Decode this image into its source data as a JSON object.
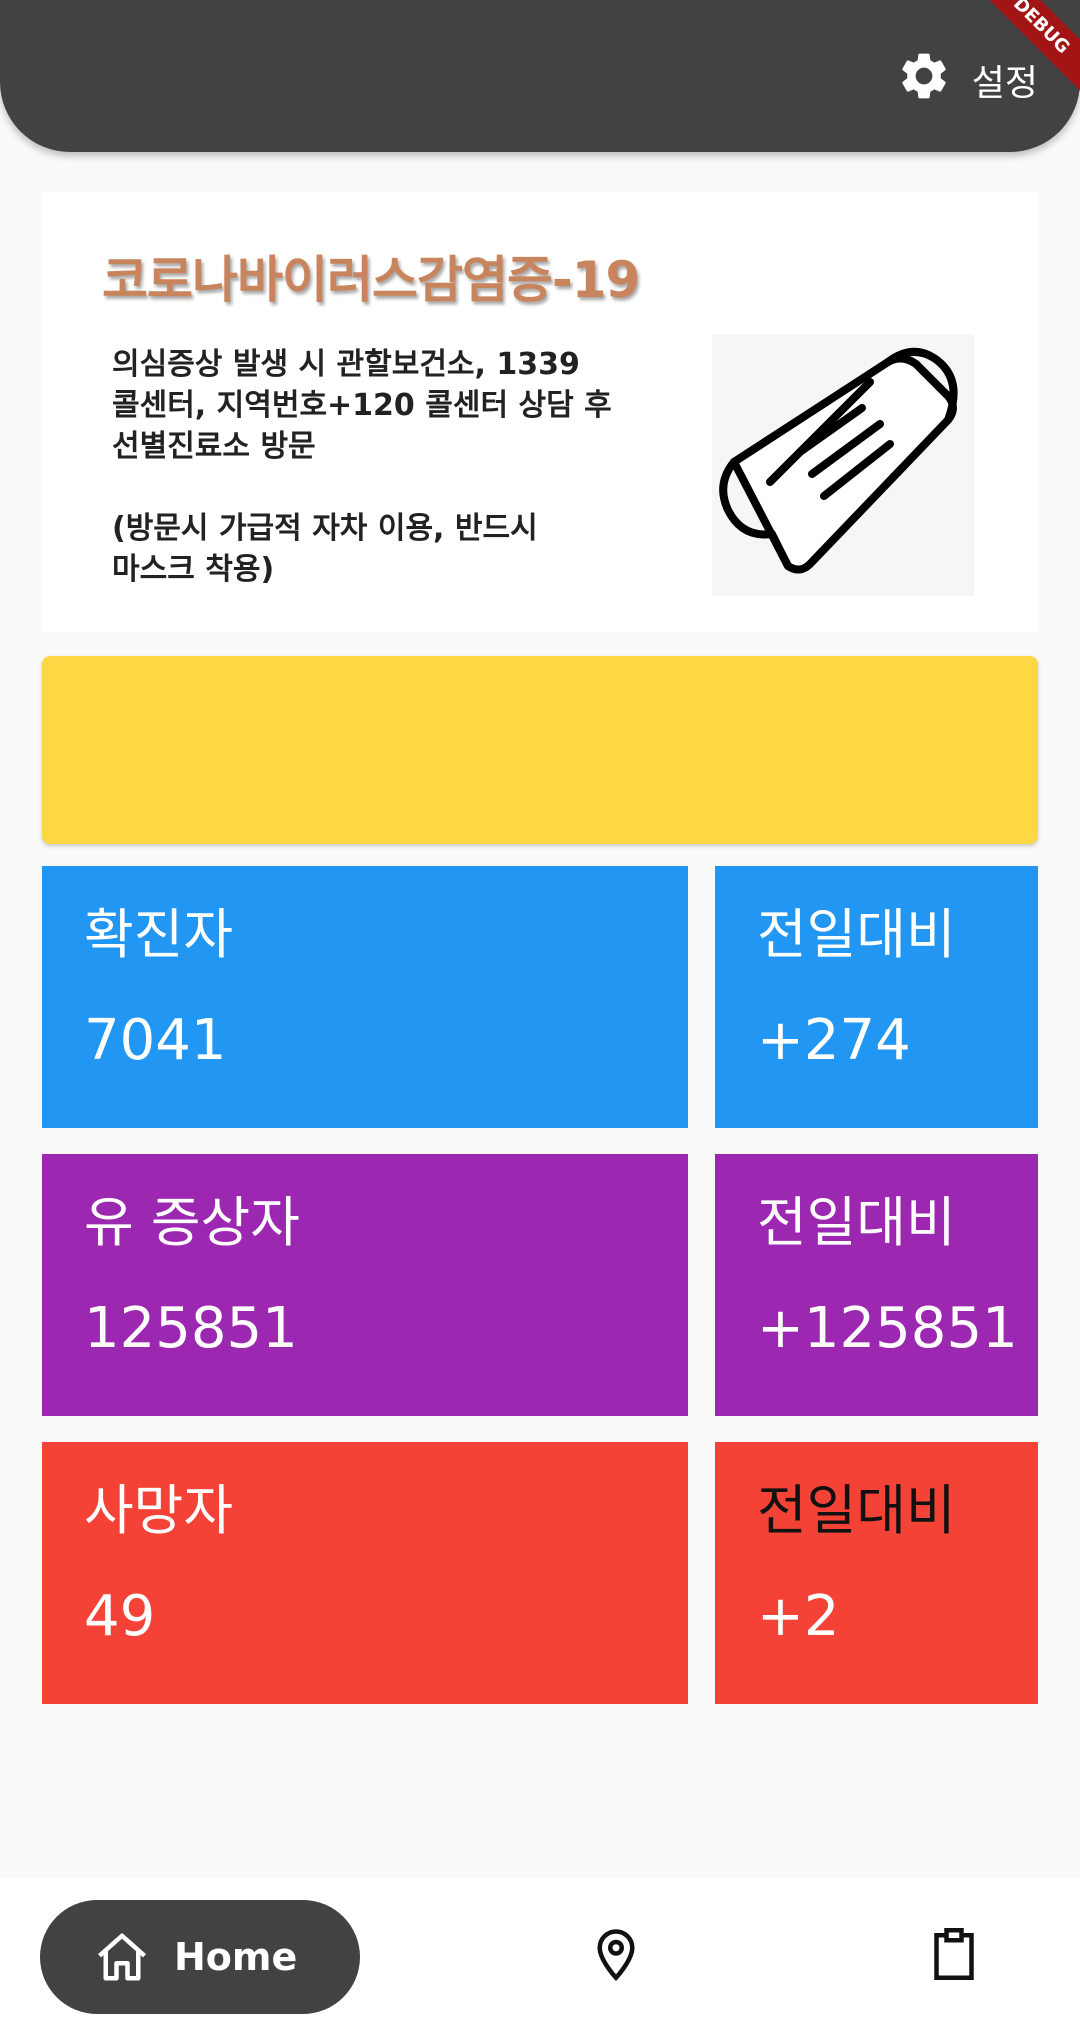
{
  "appbar": {
    "settings_label": "설정",
    "settings_icon": "gear-icon",
    "debug_banner": "DEBUG"
  },
  "info_card": {
    "title": "코로나바이러스감염증-19",
    "body": "의심증상 발생 시 관할보건소, 1339\n콜센터, 지역번호+120 콜센터 상담 후\n선별진료소 방문\n\n(방문시 가급적 자차 이용, 반드시\n마스크 착용)",
    "image_icon": "face-mask-icon"
  },
  "colors": {
    "confirmed": "#2196f3",
    "suspected": "#9c27b0",
    "deaths": "#f44336",
    "banner": "#fdd844",
    "appbar": "#424242"
  },
  "stats": {
    "confirmed": {
      "label": "확진자",
      "value": "7041",
      "diff_label": "전일대비",
      "diff_value": "+274"
    },
    "suspected": {
      "label": "유 증상자",
      "value": "125851",
      "diff_label": "전일대비",
      "diff_value": "+125851"
    },
    "deaths": {
      "label": "사망자",
      "value": "49",
      "diff_label": "전일대비",
      "diff_value": "+2"
    }
  },
  "bottom_nav": {
    "home_label": "Home",
    "items": [
      "home-icon",
      "location-pin-icon",
      "clipboard-icon"
    ]
  }
}
